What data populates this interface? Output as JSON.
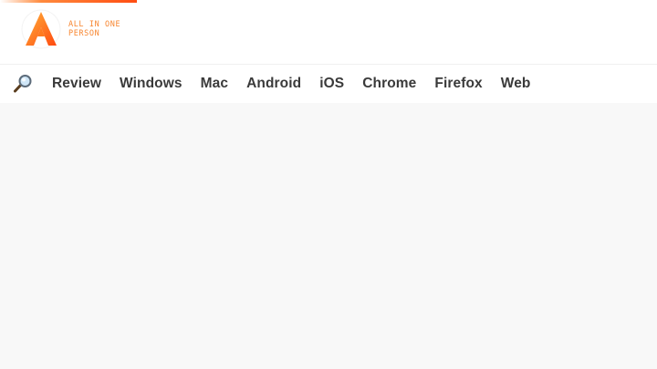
{
  "brand": {
    "line1": "ALL IN ONE",
    "line2": "PERSON",
    "accent_color": "#f7852f",
    "logo_icon": "letter-a-logo-icon"
  },
  "nav": {
    "search_icon": "magnifier-icon",
    "items": [
      {
        "label": "Review"
      },
      {
        "label": "Windows"
      },
      {
        "label": "Mac"
      },
      {
        "label": "Android"
      },
      {
        "label": "iOS"
      },
      {
        "label": "Chrome"
      },
      {
        "label": "Firefox"
      },
      {
        "label": "Web"
      }
    ]
  }
}
